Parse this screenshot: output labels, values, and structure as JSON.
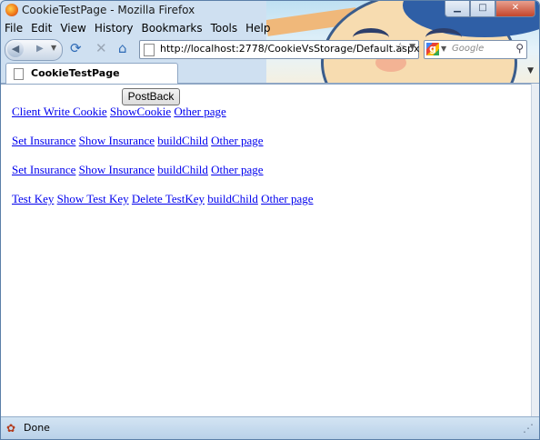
{
  "window": {
    "title": "CookieTestPage - Mozilla Firefox",
    "controls": {
      "minimize": "▁",
      "maximize": "□",
      "close": "✕"
    }
  },
  "menu": [
    "File",
    "Edit",
    "View",
    "History",
    "Bookmarks",
    "Tools",
    "Help"
  ],
  "navigation": {
    "url": "http://localhost:2778/CookieVsStorage/Default.aspx",
    "search_placeholder": "Google",
    "icons": [
      "back-icon",
      "forward-icon",
      "reload-icon",
      "stop-icon",
      "home-icon",
      "bookmark-star-icon",
      "search-icon"
    ]
  },
  "tab": {
    "label": "CookieTestPage"
  },
  "page": {
    "postback_label": "PostBack",
    "row1": [
      "Client Write Cookie",
      "ShowCookie",
      "Other page"
    ],
    "row2": [
      "Set Insurance",
      "Show Insurance",
      "buildChild",
      "Other page"
    ],
    "row3": [
      "Set Insurance",
      "Show Insurance",
      "buildChild",
      "Other page"
    ],
    "row4": [
      "Test Key",
      "Show Test Key",
      "Delete TestKey",
      "buildChild",
      "Other page"
    ]
  },
  "status": {
    "text": "Done"
  },
  "colors": {
    "link": "#0000ee",
    "frame": "#cfe0f1",
    "status_bg": "#c6dcef"
  }
}
